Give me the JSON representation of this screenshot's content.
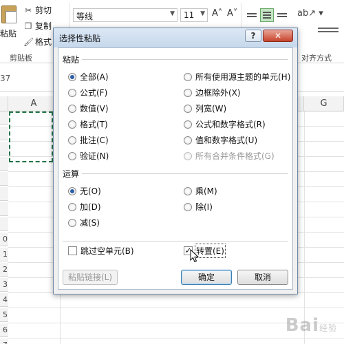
{
  "ribbon": {
    "paste_label": "粘贴",
    "cut_label": "剪切",
    "copy_label": "复制",
    "format_painter_label": "格式",
    "clipboard_group": "剪贴板",
    "font_name": "等线",
    "font_size": "11",
    "grow_font": "A˄",
    "shrink_font": "A˅",
    "orientation": "ᾊ˅",
    "align_group": "对齐方式"
  },
  "formula_bar": {
    "namebox_fragment": "37"
  },
  "grid": {
    "columns": [
      "A",
      "G"
    ],
    "rows": [
      "",
      "",
      "",
      "",
      "",
      "",
      "",
      "",
      "0",
      "1",
      "2",
      "3",
      "4",
      "5",
      "6",
      "7"
    ]
  },
  "dialog": {
    "title": "选择性粘贴",
    "help_label": "?",
    "close_label": "✕",
    "paste_section": "粘贴",
    "paste_options_left": [
      {
        "label": "全部(A)",
        "selected": true
      },
      {
        "label": "公式(F)",
        "selected": false
      },
      {
        "label": "数值(V)",
        "selected": false
      },
      {
        "label": "格式(T)",
        "selected": false
      },
      {
        "label": "批注(C)",
        "selected": false
      },
      {
        "label": "验证(N)",
        "selected": false
      }
    ],
    "paste_options_right": [
      {
        "label": "所有使用源主题的单元(H)",
        "selected": false,
        "disabled": false
      },
      {
        "label": "边框除外(X)",
        "selected": false,
        "disabled": false
      },
      {
        "label": "列宽(W)",
        "selected": false,
        "disabled": false
      },
      {
        "label": "公式和数字格式(R)",
        "selected": false,
        "disabled": false
      },
      {
        "label": "值和数字格式(U)",
        "selected": false,
        "disabled": false
      },
      {
        "label": "所有合并条件格式(G)",
        "selected": false,
        "disabled": true
      }
    ],
    "operation_section": "运算",
    "operation_left": [
      {
        "label": "无(O)",
        "selected": true
      },
      {
        "label": "加(D)",
        "selected": false
      },
      {
        "label": "减(S)",
        "selected": false
      }
    ],
    "operation_right": [
      {
        "label": "乘(M)",
        "selected": false
      },
      {
        "label": "除(I)",
        "selected": false
      }
    ],
    "skip_blanks_label": "跳过空单元(B)",
    "skip_blanks_checked": false,
    "transpose_label": "转置(E)",
    "transpose_checked": true,
    "transpose_check_glyph": "✓",
    "paste_link_label": "粘贴链接(L)",
    "ok_label": "确定",
    "cancel_label": "取消"
  },
  "watermark": {
    "brand": "Bai",
    "suffix": "经验"
  },
  "colors": {
    "accent": "#2a5fa8",
    "title_bar": "#c6d8ec",
    "close": "#c7432b",
    "selection_marquee": "#217346"
  }
}
